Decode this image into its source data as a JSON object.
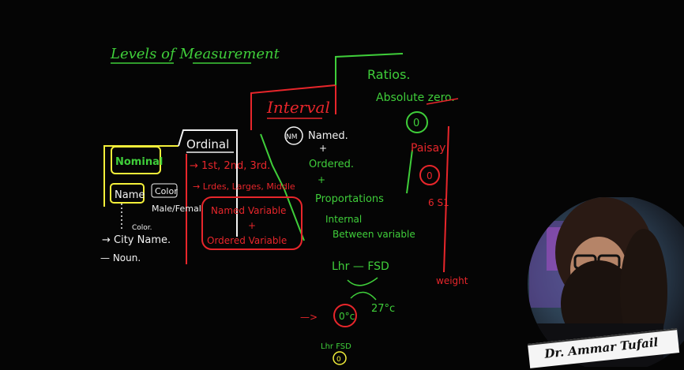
{
  "title": "Levels of Measurement",
  "nominal": {
    "heading": "Nominal",
    "name_box": "Name",
    "arrow_color": "Color",
    "gender": "Male/Femal",
    "sub_color": "Color.",
    "city": "→ City Name.",
    "noun": "— Noun."
  },
  "ordinal": {
    "heading": "Ordinal",
    "ranks": "→ 1st, 2nd, 3rd.",
    "sizes": "→ Lrdes, Larges, Middle",
    "box_line1": "Named Variable",
    "box_plus": "+",
    "box_line2": "Ordered Variable"
  },
  "interval": {
    "heading": "Interval",
    "nm_circle": "NM",
    "named": "Named.",
    "plus1": "+",
    "ordered": "Ordered.",
    "plus2": "+",
    "proportions": "Proportations",
    "internal": "Internal",
    "between": "Between variable",
    "lhr_fsd": "Lhr — FSD",
    "zero_c": "0°c",
    "temp": "27°c",
    "lhr_fsd_low": "Lhr  FSD",
    "zero_low": "0"
  },
  "ratios": {
    "heading": "Ratios.",
    "absolute": "Absolute zero.",
    "zero1": "0",
    "paisay": "Paisay",
    "zero2": "0",
    "six_s": "6 S1",
    "weight": "weight"
  },
  "caption": "Dr. Ammar Tufail",
  "colors": {
    "green": "#3fce3a",
    "red": "#e8262b",
    "yellow": "#f4f03a",
    "white": "#f2f2f2",
    "board": "#050505"
  },
  "icons": [
    "webcam-presenter-photo"
  ]
}
